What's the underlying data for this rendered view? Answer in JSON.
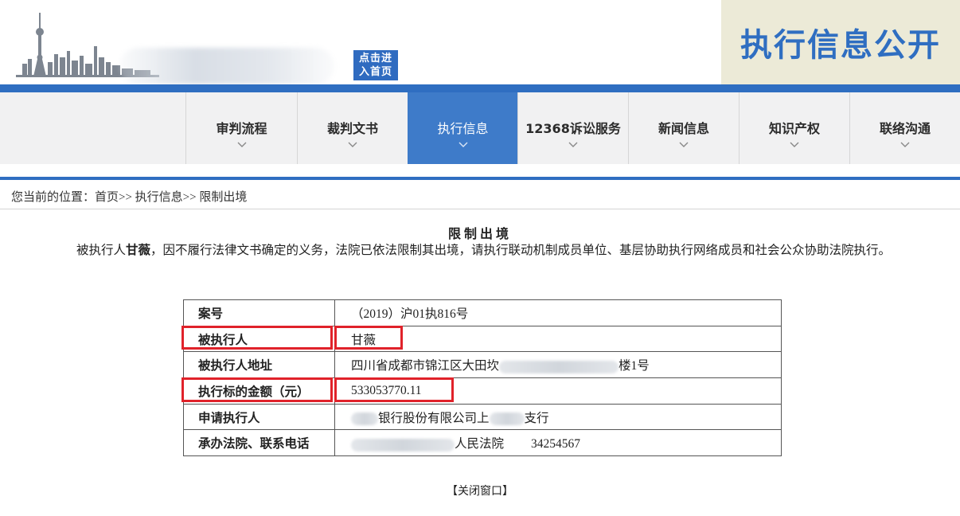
{
  "banner": {
    "home_button": [
      "点击进",
      "入首页"
    ],
    "site_title": "执行信息公开",
    "accent_color": "#2f6ec1"
  },
  "nav": {
    "items": [
      "审判流程",
      "裁判文书",
      "执行信息",
      "12368诉讼服务",
      "新闻信息",
      "知识产权",
      "联络沟通"
    ],
    "active": "执行信息"
  },
  "breadcrumb": "您当前的位置：首页>> 执行信息>> 限制出境",
  "notice": {
    "title": "限制出境",
    "name": "甘薇",
    "pre": "被执行人",
    "post": "，因不履行法律文书确定的义务，法院已依法限制其出境，请执行联动机制成员单位、基层协助执行网络成员和社会公众协助法院执行。"
  },
  "table": {
    "case_no_label": "案号",
    "case_no": "（2019）沪01执816号",
    "person_label": "被执行人",
    "person": "甘薇",
    "address_label": "被执行人地址",
    "address_start": "四川省成都市锦江区大田坎",
    "address_end": "楼1号",
    "amount_label": "执行标的金额（元）",
    "amount": "533053770.11",
    "applicant_label": "申请执行人",
    "applicant_mid": "银行股份有限公司上",
    "applicant_end": "支行",
    "court_label": "承办法院、联系电话",
    "court_mid": "人民法院",
    "court_phone": "34254567"
  },
  "close_link": "【关闭窗口】",
  "highlight_color": "#e0222a"
}
